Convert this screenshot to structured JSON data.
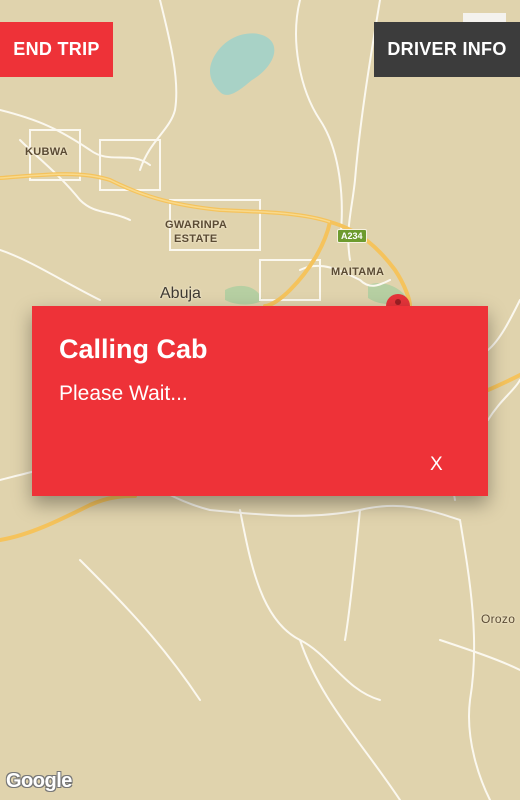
{
  "map": {
    "labels": {
      "kubwa": "KUBWA",
      "gwarinpa_line1": "GWARINPA",
      "gwarinpa_line2": "ESTATE",
      "maitama": "MAITAMA",
      "abuja": "Abuja",
      "orozo": "Orozo"
    },
    "road_shield": "A234",
    "attribution": "Google"
  },
  "toolbar": {
    "end_trip_label": "END TRIP",
    "driver_info_label": "DRIVER INFO"
  },
  "dialog": {
    "title": "Calling Cab",
    "message": "Please Wait...",
    "close_label": "X"
  },
  "colors": {
    "accent_red": "#ee3238",
    "dark_button": "#3c3c3c",
    "map_land": "#e0d3ad",
    "map_road_major": "#f5c35c",
    "water": "#a8d2c6"
  }
}
